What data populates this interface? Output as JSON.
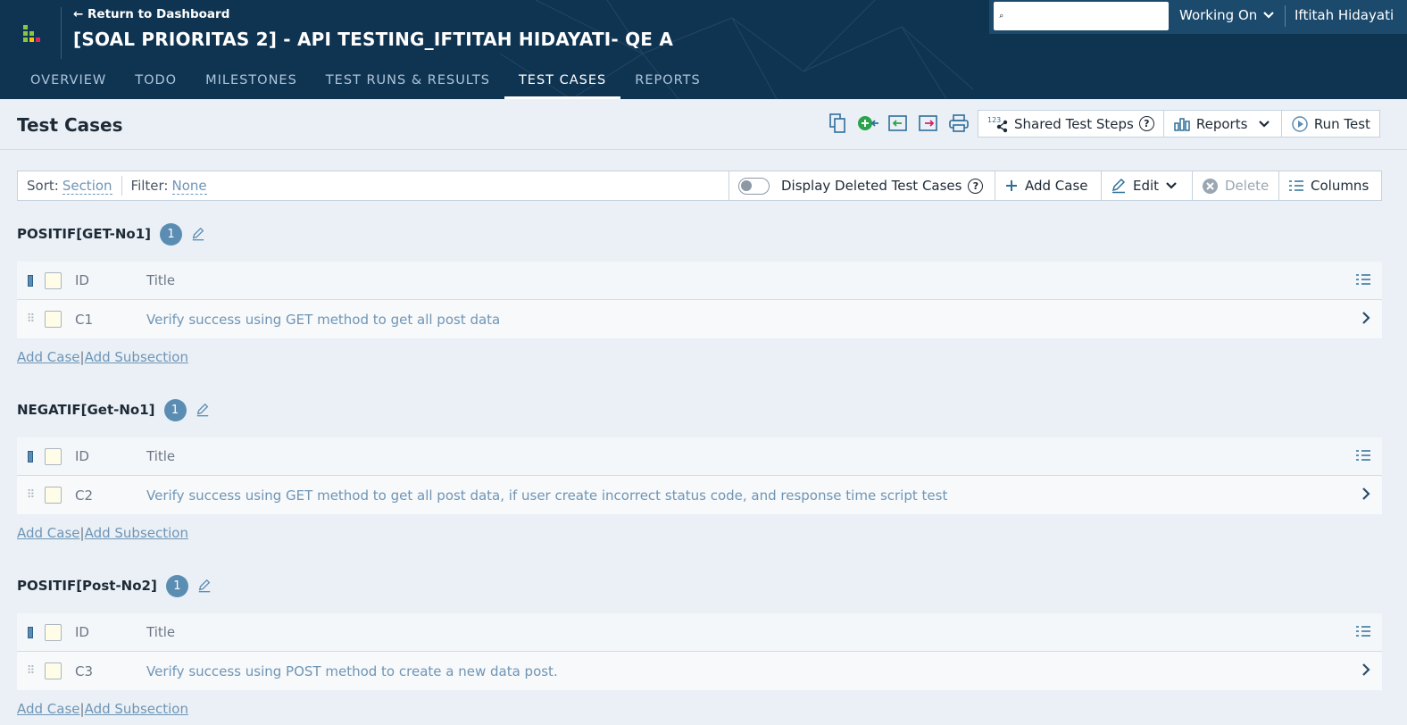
{
  "header": {
    "return_link": "← Return to Dashboard",
    "project_title": "[SOAL PRIORITAS 2] - API TESTING_IFTITAH HIDAYATI- QE A",
    "search_placeholder": "",
    "working_on": "Working On",
    "user": "Iftitah Hidayati",
    "tabs": [
      {
        "label": "OVERVIEW"
      },
      {
        "label": "TODO"
      },
      {
        "label": "MILESTONES"
      },
      {
        "label": "TEST RUNS & RESULTS"
      },
      {
        "label": "TEST CASES",
        "active": true
      },
      {
        "label": "REPORTS"
      }
    ]
  },
  "page": {
    "title": "Test Cases",
    "toolbar_icons": [
      "copy-icon",
      "add-bug-icon",
      "import-icon",
      "export-icon",
      "print-icon"
    ],
    "shared_steps_label": "Shared Test Steps",
    "reports_label": "Reports",
    "run_test_label": "Run Test"
  },
  "filterbar": {
    "sort_label": "Sort:",
    "sort_value": "Section",
    "filter_label": "Filter:",
    "filter_value": "None",
    "display_deleted": "Display Deleted Test Cases",
    "add_case": "Add Case",
    "edit": "Edit",
    "delete": "Delete",
    "columns": "Columns"
  },
  "grid_columns": {
    "id": "ID",
    "title": "Title"
  },
  "sections": [
    {
      "name": "POSITIF[GET-No1]",
      "count": "1",
      "case": {
        "id": "C1",
        "title": "Verify success using GET method to get all post data"
      }
    },
    {
      "name": "NEGATIF[Get-No1]",
      "count": "1",
      "case": {
        "id": "C2",
        "title": "Verify success using GET method to get all post data, if user create incorrect status code, and response time script test"
      }
    },
    {
      "name": "POSITIF[Post-No2]",
      "count": "1",
      "case": {
        "id": "C3",
        "title": "Verify success using POST method to create a new data post."
      }
    }
  ],
  "section_actions": {
    "add_case": "Add Case",
    "separator": "|",
    "add_subsection": "Add Subsection"
  },
  "colors": {
    "header_bg": "#0f3452",
    "accent": "#5b8db3",
    "link": "#6f95b5",
    "page_bg": "#eaf0f6"
  }
}
